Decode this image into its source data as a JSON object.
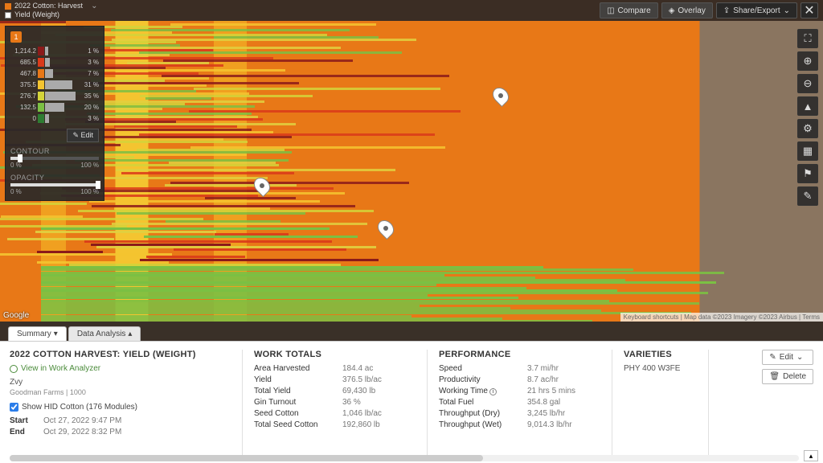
{
  "header": {
    "layer1": "2022 Cotton: Harvest",
    "layer1_color": "#e87817",
    "layer2": "Yield (Weight)",
    "layer2_color": "#ffffff",
    "compare": "Compare",
    "overlay": "Overlay",
    "share": "Share/Export"
  },
  "legend": {
    "badge": "1",
    "rows": [
      {
        "val": "1,214.2",
        "color": "#8b1a1a",
        "bar": 4,
        "pct": "1 %"
      },
      {
        "val": "685.5",
        "color": "#d93a1a",
        "bar": 6,
        "pct": "3 %"
      },
      {
        "val": "467.8",
        "color": "#e87817",
        "bar": 10,
        "pct": "7 %"
      },
      {
        "val": "375.5",
        "color": "#f4c430",
        "bar": 34,
        "pct": "31 %"
      },
      {
        "val": "276.7",
        "color": "#d4d43a",
        "bar": 38,
        "pct": "35 %"
      },
      {
        "val": "132.5",
        "color": "#7bc043",
        "bar": 24,
        "pct": "20 %"
      },
      {
        "val": "0",
        "color": "#2e7d32",
        "bar": 5,
        "pct": "3 %"
      }
    ],
    "edit": "Edit",
    "contour_label": "CONTOUR",
    "opacity_label": "OPACITY",
    "min": "0 %",
    "max": "100 %"
  },
  "map": {
    "google": "Google",
    "attribution": "Keyboard shortcuts | Map data ©2023 Imagery ©2023 Airbus | Terms"
  },
  "tabs": {
    "summary": "Summary",
    "analysis": "Data Analysis"
  },
  "panel": {
    "title": "2022 COTTON HARVEST: YIELD (WEIGHT)",
    "view_link": "View in Work Analyzer",
    "owner": "Zvy",
    "farm": "Goodman Farms | 1000",
    "show_hid": "Show HID Cotton (176 Modules)",
    "start_k": "Start",
    "start_v": "Oct 27, 2022 9:47 PM",
    "end_k": "End",
    "end_v": "Oct 29, 2022 8:32 PM",
    "work_title": "WORK TOTALS",
    "work": [
      {
        "k": "Area Harvested",
        "v": "184.4 ac"
      },
      {
        "k": "Yield",
        "v": "376.5 lb/ac"
      },
      {
        "k": "Total Yield",
        "v": "69,430 lb"
      },
      {
        "k": "Gin Turnout",
        "v": "36 %"
      },
      {
        "k": "Seed Cotton",
        "v": "1,046 lb/ac"
      },
      {
        "k": "Total Seed Cotton",
        "v": "192,860 lb"
      }
    ],
    "perf_title": "PERFORMANCE",
    "perf": [
      {
        "k": "Speed",
        "v": "3.7 mi/hr"
      },
      {
        "k": "Productivity",
        "v": "8.7 ac/hr"
      },
      {
        "k": "Working Time",
        "v": "21 hrs 5 mins",
        "info": true
      },
      {
        "k": "Total Fuel",
        "v": "354.8 gal"
      },
      {
        "k": "Throughput (Dry)",
        "v": "3,245 lb/hr"
      },
      {
        "k": "Throughput (Wet)",
        "v": "9,014.3 lb/hr"
      }
    ],
    "var_title": "VARIETIES",
    "varieties": "PHY 400 W3FE",
    "edit": "Edit",
    "delete": "Delete"
  }
}
